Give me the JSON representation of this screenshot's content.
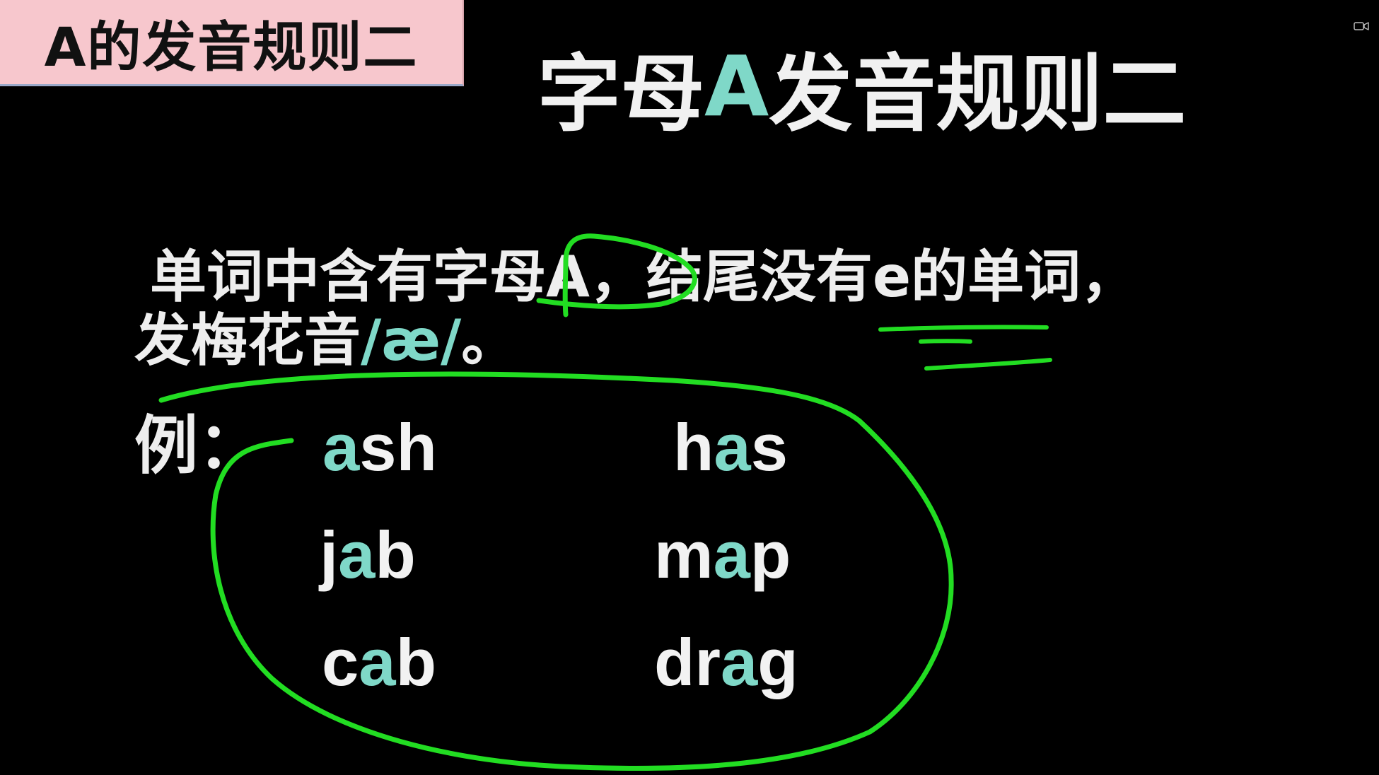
{
  "corner_label": "A的发音规则二",
  "title": {
    "prefix": "字母",
    "highlight": "A",
    "suffix": "发音规则二"
  },
  "rule": {
    "line1": "单词中含有字母A，结尾没有e的单词，",
    "line2_prefix": "发梅花音",
    "line2_phonetic": "/æ/",
    "line2_suffix": "。"
  },
  "example_label": "例：",
  "examples": [
    {
      "before": "",
      "vowel": "a",
      "after": "sh"
    },
    {
      "before": "h",
      "vowel": "a",
      "after": "s"
    },
    {
      "before": "j",
      "vowel": "a",
      "after": "b"
    },
    {
      "before": "m",
      "vowel": "a",
      "after": "p"
    },
    {
      "before": "c",
      "vowel": "a",
      "after": "b"
    },
    {
      "before": "dr",
      "vowel": "a",
      "after": "g"
    }
  ],
  "colors": {
    "background": "#000000",
    "text": "#eeeeee",
    "accent": "#7fd8c8",
    "corner_label_bg": "#f7c7cd",
    "annotation": "#22dd22"
  },
  "icons": {
    "top_right": "video-camera-icon"
  }
}
